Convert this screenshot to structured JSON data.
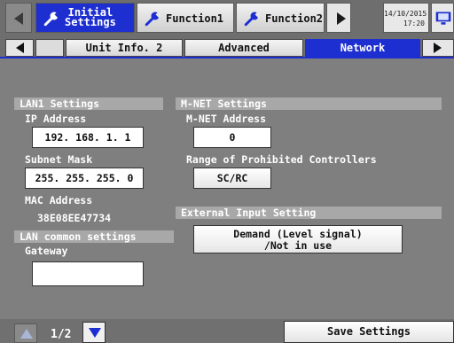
{
  "top_tabs": [
    {
      "label_line1": "Initial",
      "label_line2": "Settings",
      "active": true
    },
    {
      "label": "Function1",
      "active": false
    },
    {
      "label": "Function2",
      "active": false
    }
  ],
  "clock": {
    "date": "14/10/2015",
    "time": "17:20"
  },
  "sub_tabs": [
    {
      "label": "Unit Info. 2",
      "active": false
    },
    {
      "label": "Advanced",
      "active": false
    },
    {
      "label": "Network",
      "active": true
    }
  ],
  "left_panel": {
    "lan1_header": "LAN1 Settings",
    "ip_label": "IP Address",
    "ip_value": "192. 168. 1. 1",
    "subnet_label": "Subnet Mask",
    "subnet_value": "255. 255. 255. 0",
    "mac_label": "MAC Address",
    "mac_value": "38E08EE47734",
    "lan_common_header": "LAN common settings",
    "gateway_label": "Gateway",
    "gateway_value": ""
  },
  "right_panel": {
    "mnet_header": "M-NET Settings",
    "mnet_address_label": "M-NET Address",
    "mnet_address_value": "0",
    "prohibited_label": "Range of Prohibited Controllers",
    "prohibited_value": "SC/RC",
    "external_header": "External Input Setting",
    "external_value_line1": "Demand (Level signal)",
    "external_value_line2": "/Not in use"
  },
  "pager": {
    "text": "1/2"
  },
  "save_label": "Save Settings",
  "colors": {
    "accent": "#1e2fd1",
    "background": "#7f7f7f"
  }
}
